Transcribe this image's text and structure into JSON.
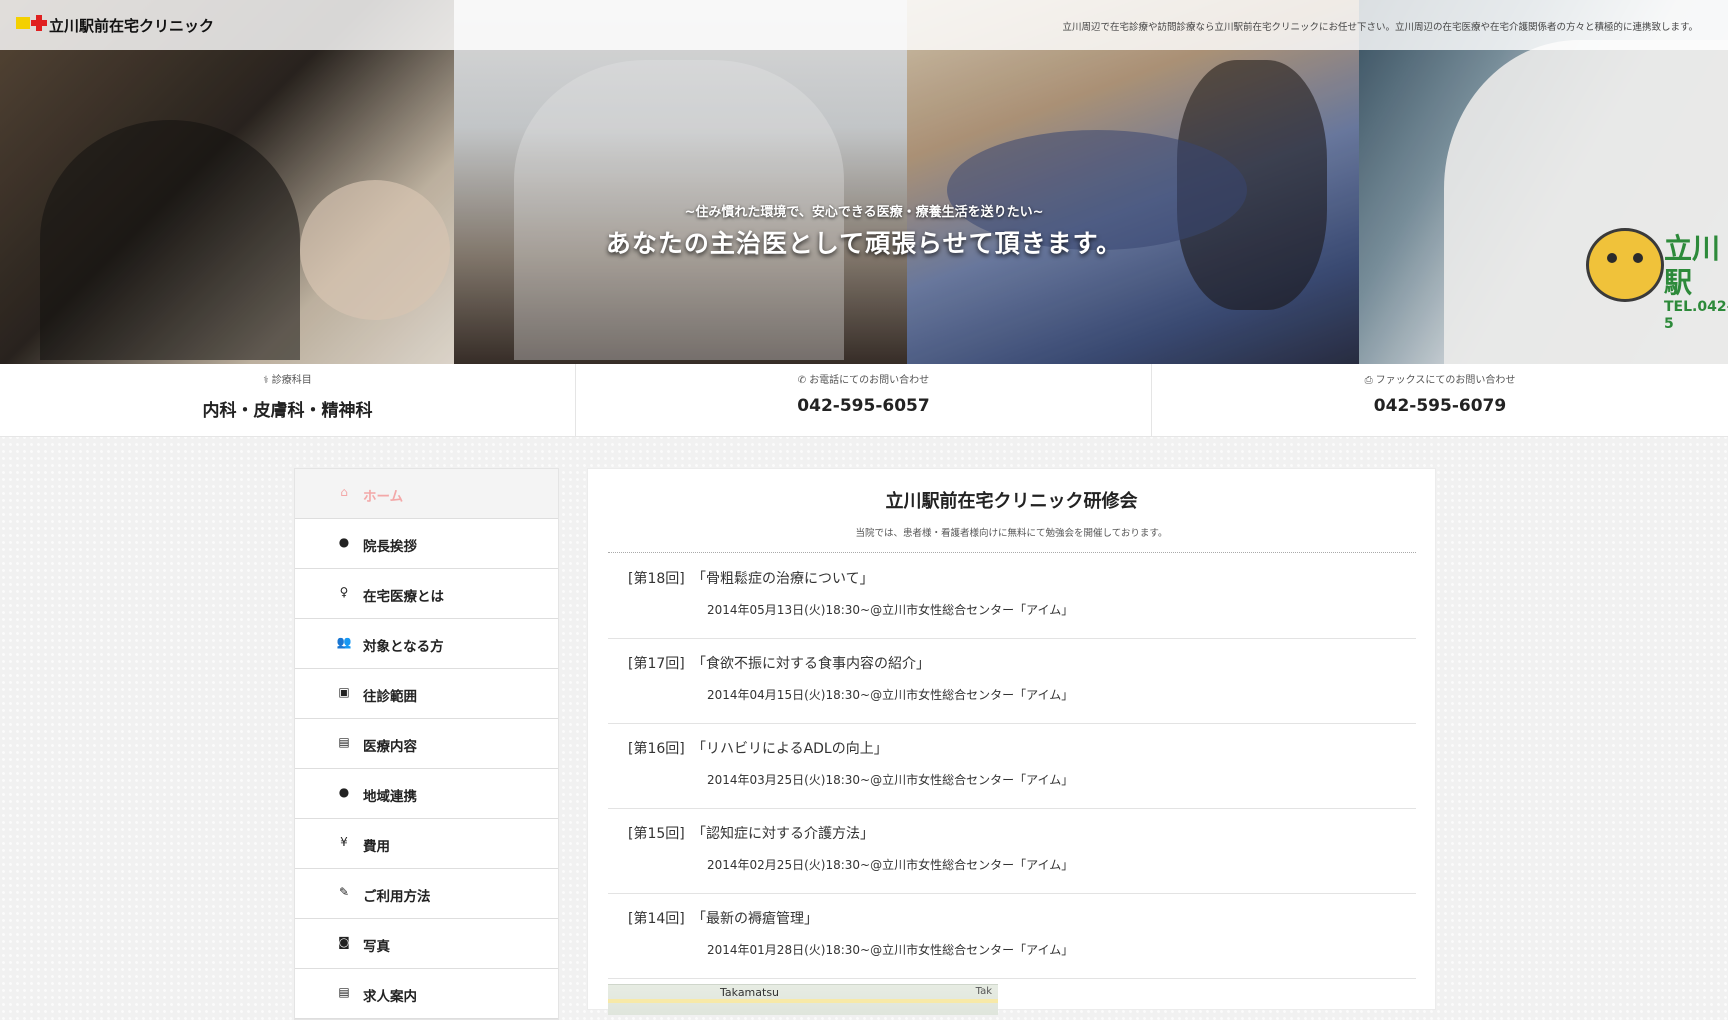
{
  "header": {
    "site_name": "立川駅前在宅クリニック",
    "tagline": "立川周辺で在宅診療や訪問診療なら立川駅前在宅クリニックにお任せ下さい。立川周辺の在宅医療や在宅介護関係者の方々と積極的に連携致します。"
  },
  "hero": {
    "subtitle": "~住み慣れた環境で、安心できる医療・療養生活を送りたい~",
    "headline": "あなたの主治医として頑張らせて頂きます。",
    "car_text": "立川駅",
    "car_tel": "TEL.042-5"
  },
  "info": {
    "departments_label": "診療科目",
    "departments_value": "内科・皮膚科・精神科",
    "phone_label": "お電話にてのお問い合わせ",
    "phone_value": "042-595-6057",
    "fax_label": "ファックスにてのお問い合わせ",
    "fax_value": "042-595-6079"
  },
  "sidebar": {
    "items": [
      {
        "label": "ホーム",
        "icon": "home-icon",
        "glyph": "⌂"
      },
      {
        "label": "院長挨拶",
        "icon": "comment-icon",
        "glyph": "●"
      },
      {
        "label": "在宅医療とは",
        "icon": "lightbulb-icon",
        "glyph": "♀"
      },
      {
        "label": "対象となる方",
        "icon": "users-icon",
        "glyph": "👥"
      },
      {
        "label": "往診範囲",
        "icon": "ambulance-icon",
        "glyph": "▣"
      },
      {
        "label": "医療内容",
        "icon": "medkit-icon",
        "glyph": "▤"
      },
      {
        "label": "地域連携",
        "icon": "globe-icon",
        "glyph": "●"
      },
      {
        "label": "費用",
        "icon": "yen-icon",
        "glyph": "¥"
      },
      {
        "label": "ご利用方法",
        "icon": "pencil-icon",
        "glyph": "✎"
      },
      {
        "label": "写真",
        "icon": "camera-icon",
        "glyph": "◙"
      },
      {
        "label": "求人案内",
        "icon": "document-icon",
        "glyph": "▤"
      }
    ]
  },
  "main": {
    "title": "立川駅前在宅クリニック研修会",
    "subtitle": "当院では、患者様・看護者様向けに無料にて勉強会を開催しております。",
    "lectures": [
      {
        "no": "[第18回]",
        "title": "「骨粗鬆症の治療について」",
        "date": "2014年05月13日(火)18:30~@立川市女性総合センター「アイム」"
      },
      {
        "no": "[第17回]",
        "title": "「食欲不振に対する食事内容の紹介」",
        "date": "2014年04月15日(火)18:30~@立川市女性総合センター「アイム」"
      },
      {
        "no": "[第16回]",
        "title": "「リハビリによるADLの向上」",
        "date": "2014年03月25日(火)18:30~@立川市女性総合センター「アイム」"
      },
      {
        "no": "[第15回]",
        "title": "「認知症に対する介護方法」",
        "date": "2014年02月25日(火)18:30~@立川市女性総合センター「アイム」"
      },
      {
        "no": "[第14回]",
        "title": "「最新の褥瘡管理」",
        "date": "2014年01月28日(火)18:30~@立川市女性総合センター「アイム」"
      }
    ],
    "map_label": "Takamatsu",
    "map_label2": "Tak"
  },
  "colors": {
    "active_nav": "#f3a8a8",
    "logo_red": "#e02020",
    "logo_yellow": "#f4d000"
  }
}
